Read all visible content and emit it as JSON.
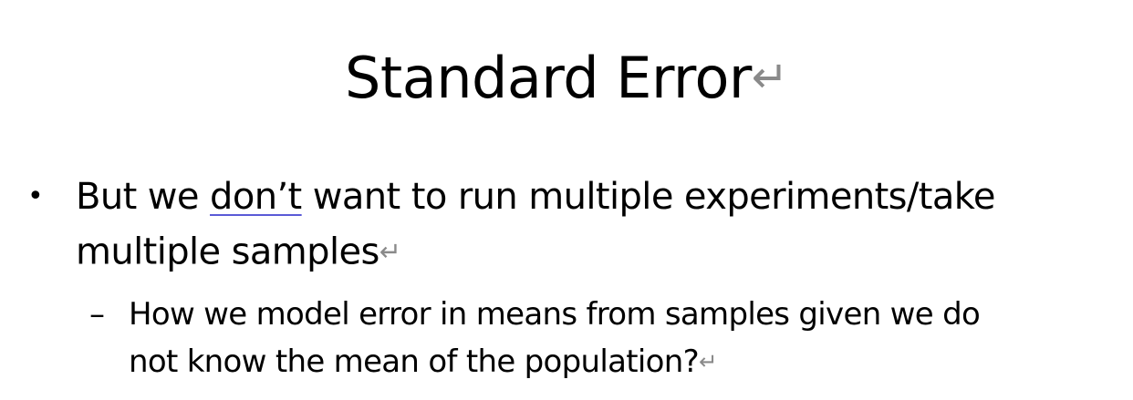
{
  "slide": {
    "title": "Standard Error",
    "paragraph_mark": "↵",
    "bullet_1": {
      "marker": "•",
      "line_1_before": "But we ",
      "line_1_flagged": "don’t",
      "line_1_after": " want to run multiple experiments/take",
      "line_2": "multiple samples"
    },
    "bullet_2": {
      "marker": "–",
      "line_1": "How we model error in means from samples given we do",
      "line_2": "not know the mean of the population?"
    }
  }
}
